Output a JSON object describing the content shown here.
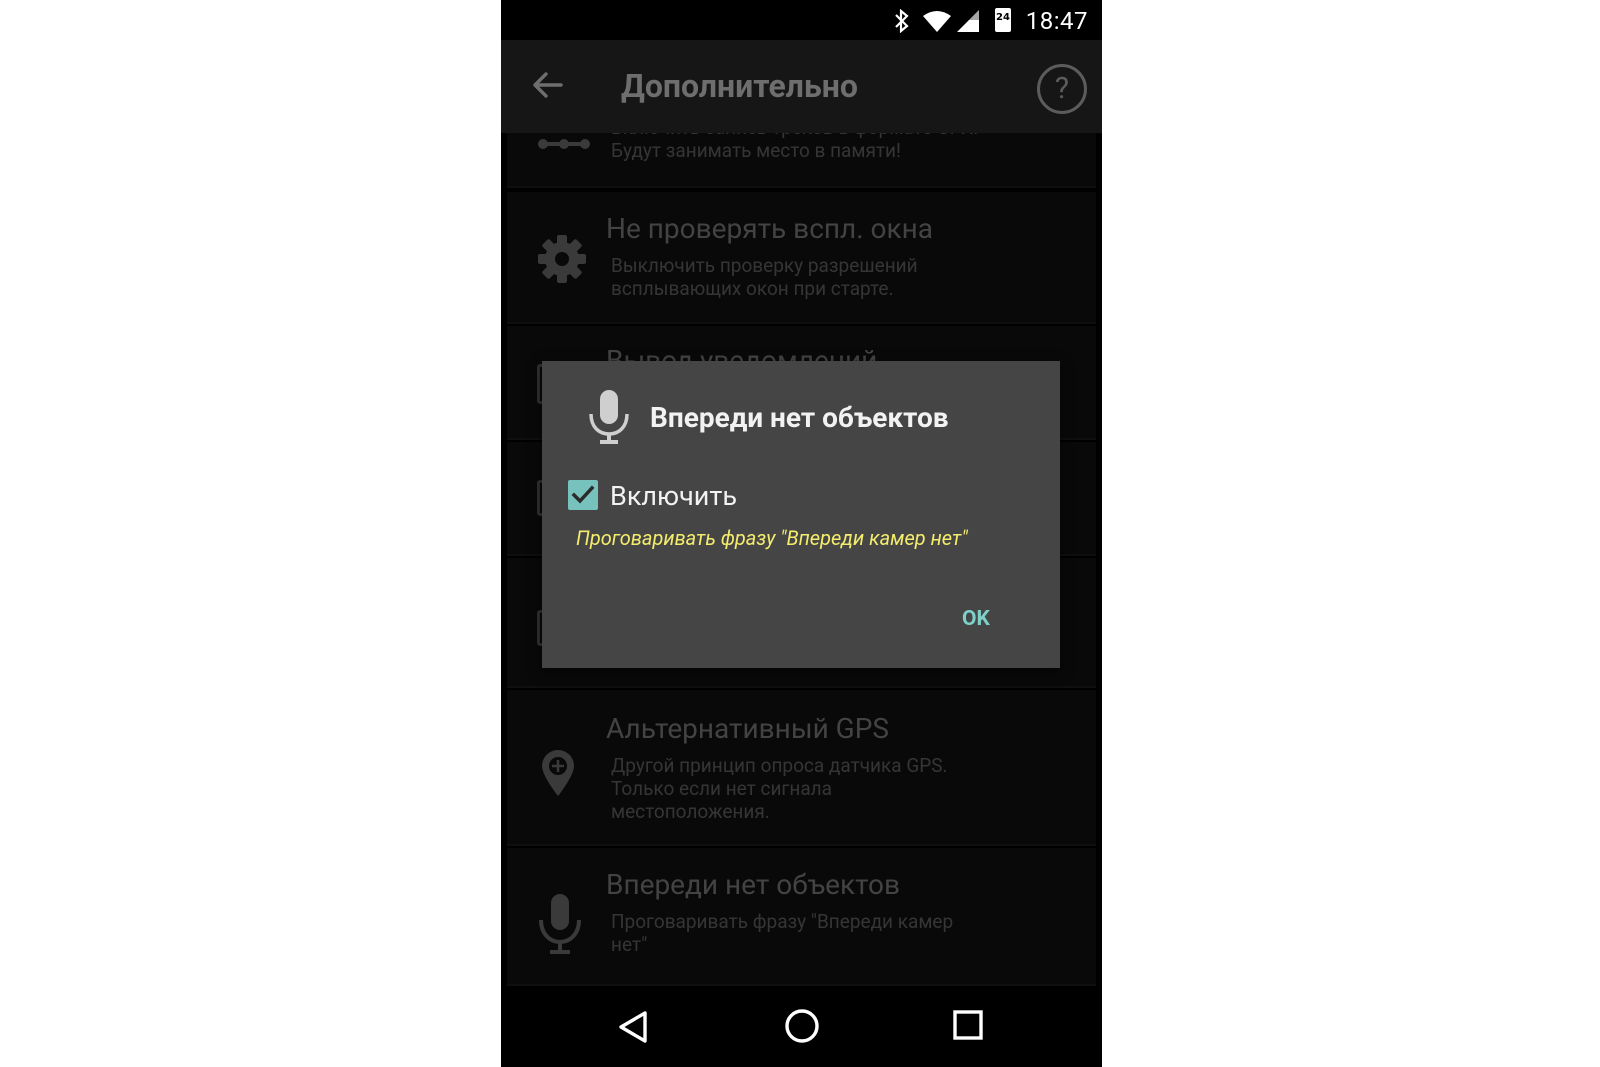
{
  "status_bar": {
    "time": "18:47",
    "battery_text": "24",
    "icons": [
      "bluetooth-icon",
      "wifi-icon",
      "cell-signal-icon",
      "battery-icon"
    ]
  },
  "app_bar": {
    "title": "Дополнительно",
    "back_icon": "arrow-left-icon",
    "help_icon": "question-circle-icon",
    "help_glyph": "?"
  },
  "settings": {
    "items": [
      {
        "title": "",
        "subtitle_line1": "Включить запись треков в формате GPX.",
        "subtitle_line2": "Будут занимать место в памяти!",
        "icon": "track-icon"
      },
      {
        "title": "Не проверять вспл. окна",
        "subtitle_line1": "Выключить проверку разрешений",
        "subtitle_line2": "всплывающих окон при старте.",
        "icon": "gear-icon"
      },
      {
        "title": "Вывод уведомлений",
        "icon": "checkbox-icon"
      },
      {
        "icon": "checkbox-icon"
      },
      {
        "icon": "checkbox-icon"
      },
      {
        "title": "Альтернативный GPS",
        "subtitle_line1": "Другой принцип опроса датчика GPS.",
        "subtitle_line2": "Только если нет сигнала",
        "subtitle_line3": "местоположения.",
        "icon": "location-pin-icon"
      },
      {
        "title": "Впереди нет объектов",
        "subtitle_line1": "Проговаривать фразу \"Впереди камер",
        "subtitle_line2": "нет\"",
        "icon": "microphone-icon"
      }
    ]
  },
  "dialog": {
    "title": "Впереди нет объектов",
    "icon": "microphone-icon",
    "checkbox_label": "Включить",
    "checkbox_checked": true,
    "description": "Проговаривать фразу \"Впереди камер нет\"",
    "ok_label": "OK",
    "accent_color": "#7fd0c8",
    "description_color": "#f4ec6c"
  },
  "nav_bar": {
    "icons": [
      "nav-back-icon",
      "nav-home-icon",
      "nav-recents-icon"
    ]
  }
}
